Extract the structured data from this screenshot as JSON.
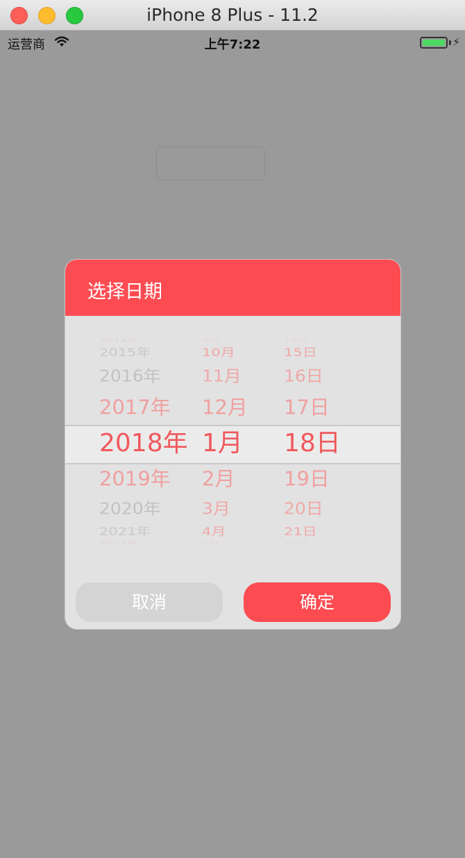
{
  "window": {
    "title": "iPhone 8 Plus - 11.2"
  },
  "status_bar": {
    "carrier": "运营商",
    "time": "上午7:22",
    "battery_color": "#4cd964"
  },
  "dialog": {
    "title": "选择日期",
    "accent_color": "#fc4c52",
    "picker": {
      "years": [
        "2014年",
        "2015年",
        "2016年",
        "2017年",
        "2018年",
        "2019年",
        "2020年",
        "2021年",
        "2022年"
      ],
      "months": [
        "9月",
        "10月",
        "11月",
        "12月",
        "1月",
        "2月",
        "3月",
        "4月",
        "5月"
      ],
      "days": [
        "14日",
        "15日",
        "16日",
        "17日",
        "18日",
        "19日",
        "20日",
        "21日",
        "22日"
      ],
      "selected": {
        "year": "2018年",
        "month": "1月",
        "day": "18日"
      }
    },
    "cancel_label": "取消",
    "confirm_label": "确定"
  }
}
